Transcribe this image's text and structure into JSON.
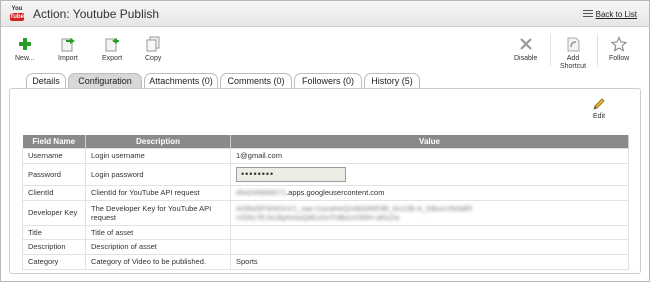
{
  "window": {
    "title": "Action: Youtube Publish",
    "logo": {
      "you": "You",
      "tube": "Tube"
    },
    "back_label": "Back to List"
  },
  "toolbar": {
    "new": "New...",
    "import": "Import",
    "export": "Export",
    "copy": "Copy",
    "disable": "Disable",
    "add_shortcut": "Add Shortcut",
    "follow": "Follow"
  },
  "tabs": [
    "Details",
    "Configuration",
    "Attachments (0)",
    "Comments (0)",
    "Followers (0)",
    "History (5)"
  ],
  "active_tab": "Configuration",
  "edit_label": "Edit",
  "table": {
    "headers": [
      "Field Name",
      "Description",
      "Value"
    ],
    "rows": [
      {
        "field": "Username",
        "description": "Login username",
        "value": "1@gmail.com"
      },
      {
        "field": "Password",
        "description": "Login password",
        "value": "••••••••"
      },
      {
        "field": "ClientId",
        "description": "ClientId for YouTube API request",
        "value_hidden": "464245668571",
        "value": ".apps.googleusercontent.com"
      },
      {
        "field": "Developer Key",
        "description": "The Developer Key for YouTube API request",
        "value_hidden": "AI39si5P3HrDnV1_vae-i1ocaHeQnrBd3RE9B_6n12B-A_O8cxr1fe0dRlVGRz7EJAJ4pHr4oQ8DzhvTHBecHSRH-aRzZw"
      },
      {
        "field": "Title",
        "description": "Title of asset",
        "value": ""
      },
      {
        "field": "Description",
        "description": "Description of asset",
        "value": ""
      },
      {
        "field": "Category",
        "description": "Category of Video to be published.",
        "value": "Sports"
      }
    ]
  },
  "colors": {
    "header_bg": "#8a8a8a",
    "new_icon": "#2a9a2a",
    "logo_red": "#d42222"
  }
}
